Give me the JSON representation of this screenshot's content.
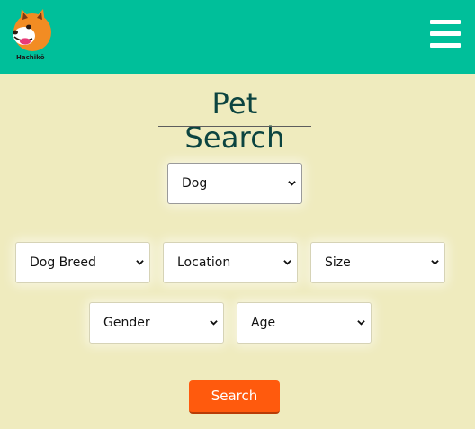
{
  "header": {
    "logo_text": "Hachikō",
    "background_color": "#00bf9a",
    "menu_icon": "hamburger-menu-icon"
  },
  "page": {
    "title": "Pet Search",
    "background_color": "#efebbe"
  },
  "filters": {
    "pet_type": "Dog",
    "breed": "Dog Breed",
    "location": "Location",
    "size": "Size",
    "gender": "Gender",
    "age": "Age",
    "dropdown_icon": "chevron-down-icon"
  },
  "actions": {
    "search_label": "Search",
    "search_color": "#ff5a0d"
  }
}
